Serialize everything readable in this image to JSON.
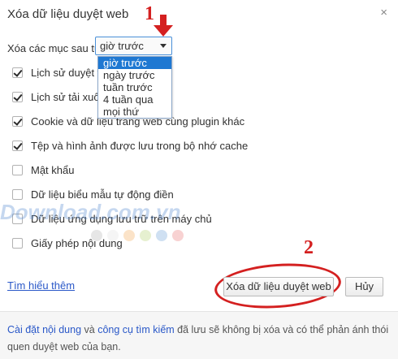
{
  "dialog": {
    "title": "Xóa dữ liệu duyệt web",
    "close_glyph": "×"
  },
  "period": {
    "label": "Xóa các mục sau từ:",
    "selected": "giờ trước",
    "options": [
      "giờ trước",
      "ngày trước",
      "tuần trước",
      "4 tuần qua",
      "mọi thứ"
    ],
    "highlighted_index": 0
  },
  "items": [
    {
      "label": "Lịch sử duyệt web",
      "checked": true
    },
    {
      "label": "Lịch sử tải xuống",
      "checked": true
    },
    {
      "label": "Cookie và dữ liệu trang web cùng plugin khác",
      "checked": true
    },
    {
      "label": "Tệp và hình ảnh được lưu trong bộ nhớ cache",
      "checked": true
    },
    {
      "label": "Mật khẩu",
      "checked": false
    },
    {
      "label": "Dữ liệu biểu mẫu tự động điền",
      "checked": false
    },
    {
      "label": "Dữ liệu ứng dụng lưu trữ trên máy chủ",
      "checked": false
    },
    {
      "label": "Giấy phép nội dung",
      "checked": false
    }
  ],
  "actions": {
    "learn_more": "Tìm hiểu thêm",
    "clear_button": "Xóa dữ liệu duyệt web",
    "cancel_button": "Hủy"
  },
  "footer": {
    "link1": "Cài đặt nội dung",
    "mid1": " và ",
    "link2": "công cụ tìm kiếm",
    "rest": " đã lưu sẽ không bị xóa và có thể phản ánh thói quen duyệt web của bạn."
  },
  "annotations": {
    "step1": "1",
    "step2": "2",
    "color": "#d42020"
  },
  "watermark": {
    "text": "Download.com.vn",
    "dot_colors": [
      "#e6e6e6",
      "#f5f5f5",
      "#fbe3c8",
      "#e6f0d0",
      "#cfe0f2",
      "#f8d2d2"
    ]
  }
}
